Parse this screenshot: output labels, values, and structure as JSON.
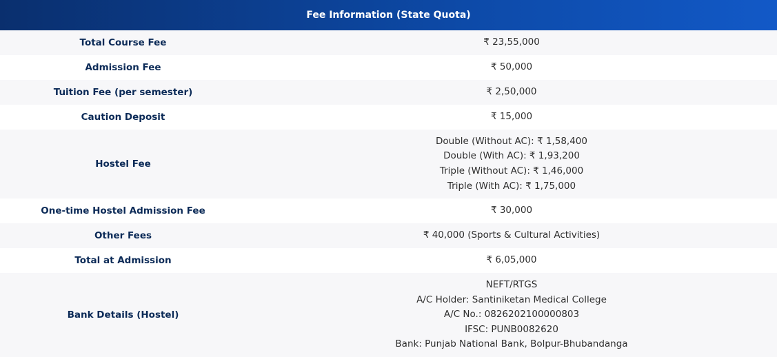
{
  "table": {
    "title": "Fee Information (State Quota)",
    "rows": [
      {
        "label": "Total Course Fee",
        "values": [
          "₹ 23,55,000"
        ]
      },
      {
        "label": "Admission Fee",
        "values": [
          "₹ 50,000"
        ]
      },
      {
        "label": "Tuition Fee (per semester)",
        "values": [
          "₹ 2,50,000"
        ]
      },
      {
        "label": "Caution Deposit",
        "values": [
          "₹ 15,000"
        ]
      },
      {
        "label": "Hostel Fee",
        "values": [
          "Double (Without AC): ₹ 1,58,400",
          "Double (With AC): ₹ 1,93,200",
          "Triple (Without AC): ₹ 1,46,000",
          "Triple (With AC): ₹ 1,75,000"
        ]
      },
      {
        "label": "One-time Hostel Admission Fee",
        "values": [
          "₹ 30,000"
        ]
      },
      {
        "label": "Other Fees",
        "values": [
          "₹ 40,000 (Sports & Cultural Activities)"
        ]
      },
      {
        "label": "Total at Admission",
        "values": [
          "₹ 6,05,000"
        ]
      },
      {
        "label": "Bank Details (Hostel)",
        "values": [
          "NEFT/RTGS",
          "A/C Holder: Santiniketan Medical College",
          "A/C No.: 0826202100000803",
          "IFSC: PUNB0082620",
          "Bank: Punjab National Bank, Bolpur-Bhubandanga"
        ]
      }
    ]
  },
  "colors": {
    "header_start": "#0a2f6e",
    "header_end": "#1259c7",
    "label_text": "#0b2a57",
    "row_alt": "#f7f7f9"
  }
}
